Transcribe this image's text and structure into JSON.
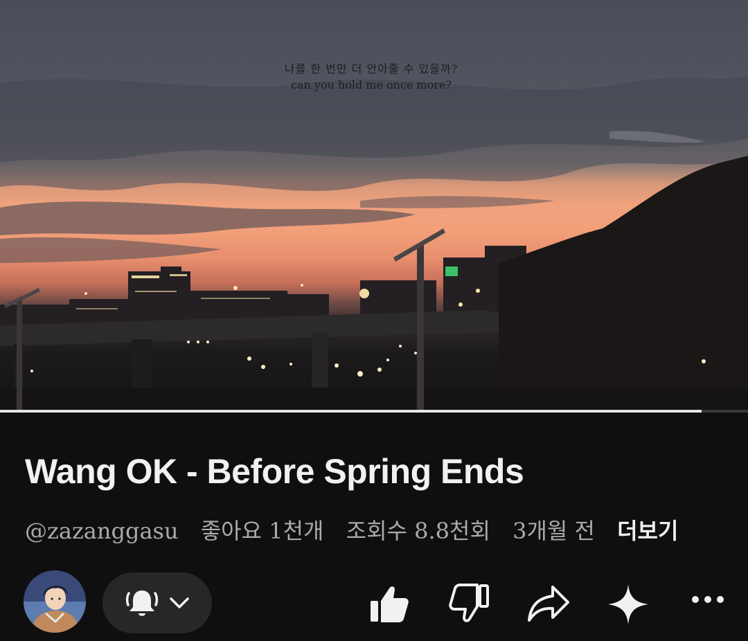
{
  "video": {
    "caption_ko": "나를 한 번만 더 안아줄 수 있을까?",
    "caption_en": "can you hold me once more?",
    "progress_percent": 93.8
  },
  "title": "Wang OK - Before Spring Ends",
  "meta": {
    "channel": "@zazanggasu",
    "likes": "좋아요 1천개",
    "views": "조회수 8.8천회",
    "age": "3개월 전",
    "more": "더보기"
  },
  "actions": {
    "icons": [
      "avatar",
      "bell-icon",
      "chevron-down-icon",
      "thumbs-up-icon",
      "thumbs-down-icon",
      "share-icon",
      "sparkle-icon",
      "more-icon"
    ]
  },
  "colors": {
    "background": "#0f0f0f",
    "pill": "#272727",
    "text_primary": "#f1f1f1",
    "text_secondary": "#aaaaaa"
  }
}
